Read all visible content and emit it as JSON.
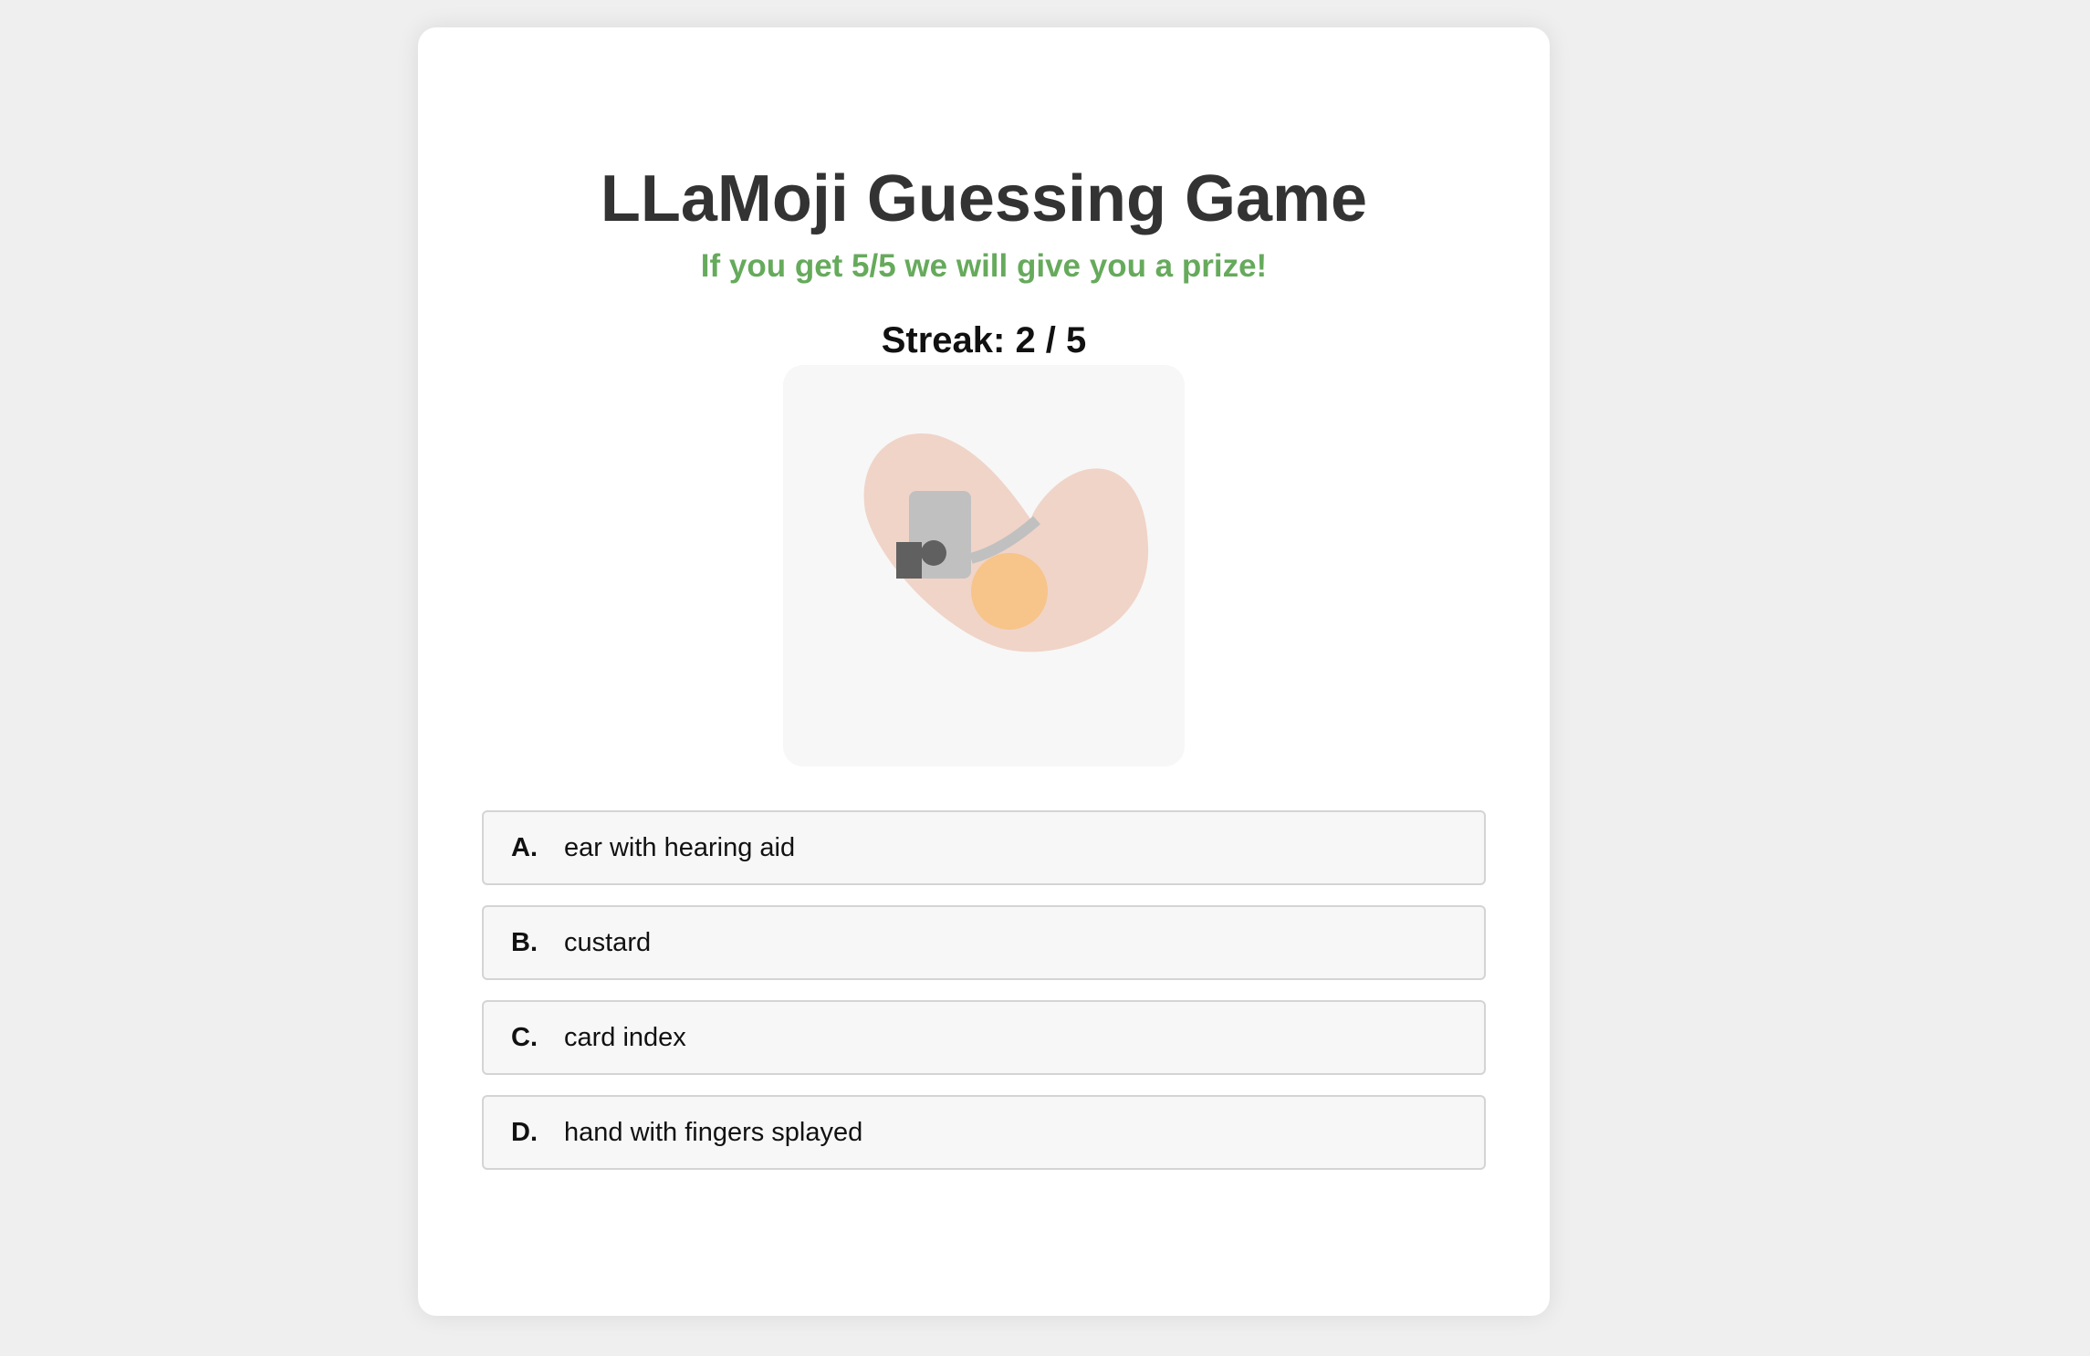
{
  "game": {
    "title": "LLaMoji Guessing Game",
    "subtitle": "If you get 5/5 we will give you a prize!",
    "streak_text": "Streak: 2 / 5",
    "streak": {
      "current": 2,
      "total": 5
    }
  },
  "emoji": {
    "icon": "ear-with-hearing-aid-icon",
    "colors": {
      "ear": "#f0d4c8",
      "device": "#c0c0c0",
      "dark": "#606060",
      "bud": "#f7c48a"
    }
  },
  "options": [
    {
      "letter": "A.",
      "text": "ear with hearing aid"
    },
    {
      "letter": "B.",
      "text": "custard"
    },
    {
      "letter": "C.",
      "text": "card index"
    },
    {
      "letter": "D.",
      "text": "hand with fingers splayed"
    }
  ],
  "colors": {
    "page_bg": "#efefef",
    "card_bg": "#ffffff",
    "title": "#333333",
    "subtitle": "#66aa5c",
    "option_bg": "#f7f7f7",
    "option_border": "#d4d4d4"
  }
}
